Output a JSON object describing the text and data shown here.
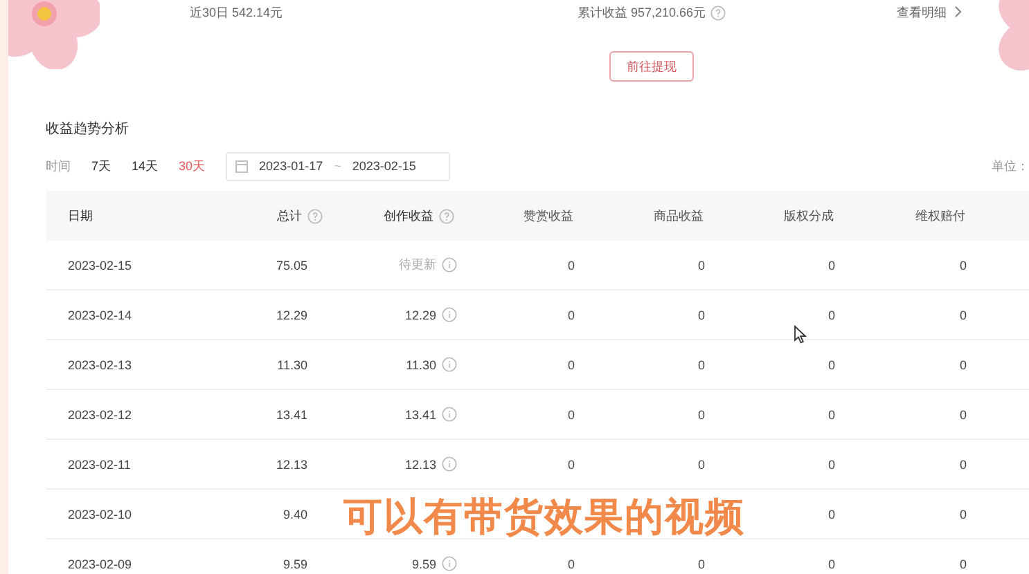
{
  "summary": {
    "recent": "近30日 542.14元",
    "total": "累计收益 957,210.66元",
    "details_link": "查看明细"
  },
  "withdraw_button": "前往提现",
  "section_title": "收益趋势分析",
  "filter": {
    "label": "时间",
    "ranges": [
      {
        "label": "7天",
        "selected": false
      },
      {
        "label": "14天",
        "selected": false
      },
      {
        "label": "30天",
        "selected": true
      }
    ],
    "date_range": {
      "start": "2023-01-17",
      "separator": "~",
      "end": "2023-02-15"
    },
    "unit": "单位："
  },
  "table": {
    "columns": [
      {
        "label": "日期",
        "help": false
      },
      {
        "label": "总计",
        "help": true
      },
      {
        "label": "创作收益",
        "help": true
      },
      {
        "label": "赞赏收益",
        "help": false
      },
      {
        "label": "商品收益",
        "help": false
      },
      {
        "label": "版权分成",
        "help": false
      },
      {
        "label": "维权赔付",
        "help": false
      }
    ],
    "rows": [
      {
        "pending": true,
        "cells": [
          "2023-02-15",
          "75.05",
          "待更新",
          "0",
          "0",
          "0",
          "0"
        ]
      },
      {
        "pending": false,
        "cells": [
          "2023-02-14",
          "12.29",
          "12.29",
          "0",
          "0",
          "0",
          "0"
        ]
      },
      {
        "pending": false,
        "cells": [
          "2023-02-13",
          "11.30",
          "11.30",
          "0",
          "0",
          "0",
          "0"
        ]
      },
      {
        "pending": false,
        "cells": [
          "2023-02-12",
          "13.41",
          "13.41",
          "0",
          "0",
          "0",
          "0"
        ]
      },
      {
        "pending": false,
        "cells": [
          "2023-02-11",
          "12.13",
          "12.13",
          "0",
          "0",
          "0",
          "0"
        ]
      },
      {
        "cells": [
          "2023-02-10",
          "9.40",
          null,
          null,
          null,
          "0",
          "0"
        ]
      },
      {
        "pending": false,
        "cells": [
          "2023-02-09",
          "9.59",
          "9.59",
          "0",
          "0",
          "0",
          "0"
        ]
      }
    ]
  },
  "caption": "可以有带货效果的视频"
}
